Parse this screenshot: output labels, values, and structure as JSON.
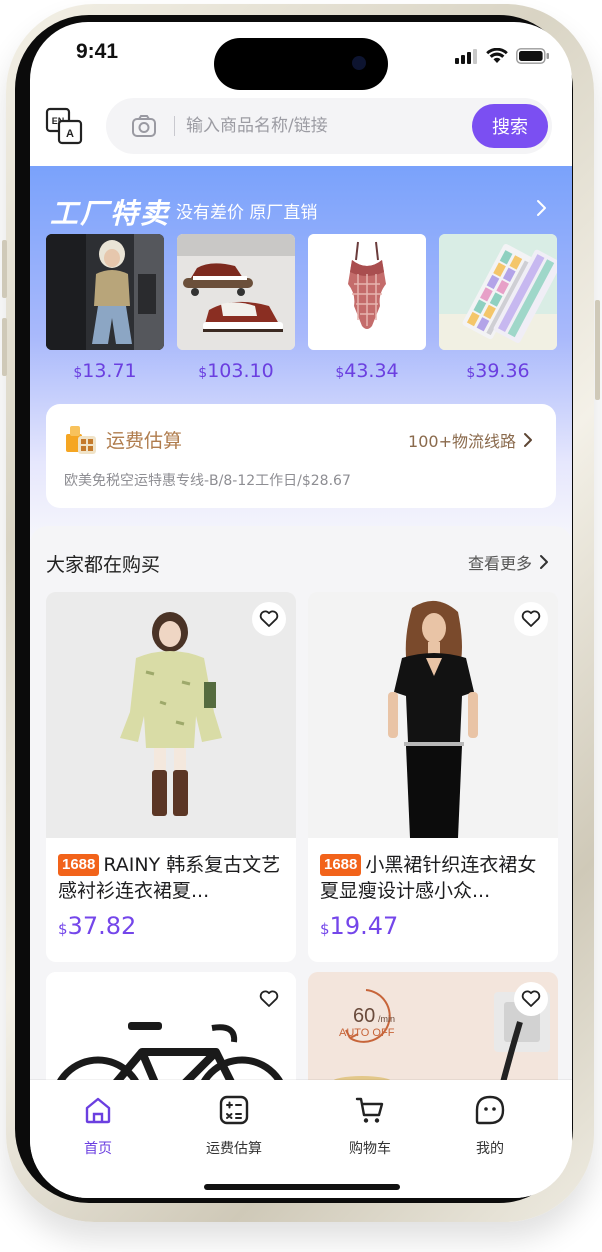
{
  "status": {
    "time": "9:41"
  },
  "search": {
    "placeholder": "输入商品名称/链接",
    "button_label": "搜索"
  },
  "factory": {
    "title": "工厂特卖",
    "subtitle": "没有差价 原厂直销",
    "deals": [
      {
        "name": "woman-in-car-photo",
        "currency": "$",
        "price": "13.71"
      },
      {
        "name": "sneakers-photo",
        "currency": "$",
        "price": "103.10"
      },
      {
        "name": "swimsuit-photo",
        "currency": "$",
        "price": "43.34"
      },
      {
        "name": "keyboard-photo",
        "currency": "$",
        "price": "39.36"
      }
    ]
  },
  "shipping": {
    "title": "运费估算",
    "routes": "100+物流线路",
    "description": "欧美免税空运特惠专线-B/8-12工作日/$28.67"
  },
  "feed": {
    "title": "大家都在购买",
    "more": "查看更多",
    "products": [
      {
        "tag": "1688",
        "name": "RAINY 韩系复古文艺感衬衫连衣裙夏...",
        "currency": "$",
        "price": "37.82"
      },
      {
        "tag": "1688",
        "name": "小黑裙针织连衣裙女夏显瘦设计感小众...",
        "currency": "$",
        "price": "19.47"
      },
      {
        "name": "bicycle-photo"
      },
      {
        "name": "appliance-photo",
        "badge_value": "60",
        "badge_unit": "/min",
        "badge_label": "AUTO OFF"
      }
    ]
  },
  "tabs": [
    {
      "label": "首页",
      "icon": "home-icon",
      "active": true
    },
    {
      "label": "运费估算",
      "icon": "calculator-icon",
      "active": false
    },
    {
      "label": "购物车",
      "icon": "cart-icon",
      "active": false
    },
    {
      "label": "我的",
      "icon": "profile-icon",
      "active": false
    }
  ],
  "colors": {
    "accent": "#7b4ff2",
    "price": "#7446ea",
    "tag": "#f2631a",
    "shipping": "#b07d4e"
  }
}
